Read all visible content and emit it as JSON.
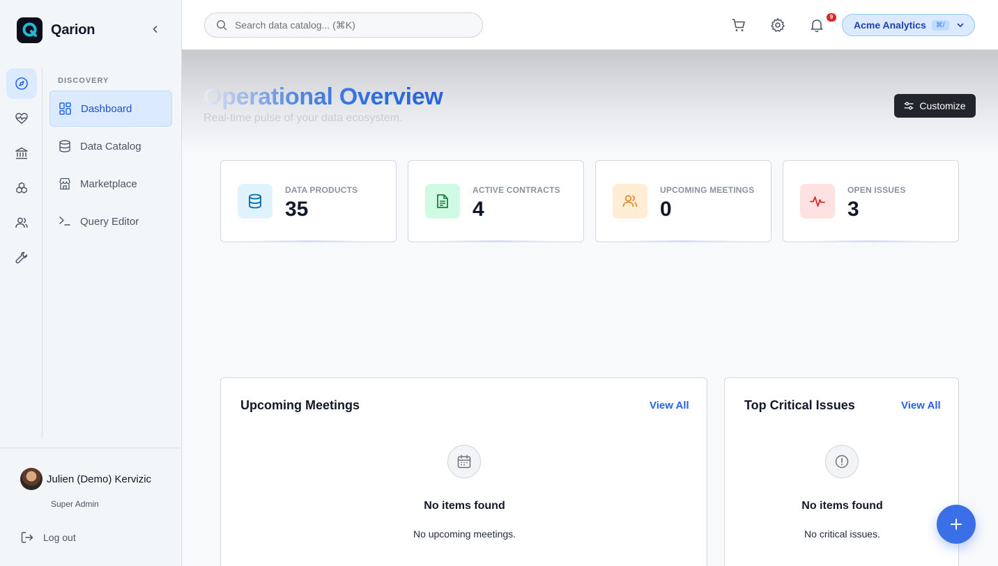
{
  "app": {
    "brand_name": "Qarion"
  },
  "sidebar": {
    "section_label": "DISCOVERY",
    "items": [
      {
        "label": "Dashboard",
        "icon": "dashboard-icon",
        "active": true
      },
      {
        "label": "Data Catalog",
        "icon": "database-icon"
      },
      {
        "label": "Marketplace",
        "icon": "store-icon"
      },
      {
        "label": "Query Editor",
        "icon": "terminal-icon"
      }
    ],
    "rail": [
      "compass-icon",
      "heart-pulse-icon",
      "institution-icon",
      "cubes-icon",
      "users-icon",
      "wrench-icon"
    ],
    "user": {
      "name": "Julien (Demo) Kervizic",
      "role": "Super Admin"
    },
    "logout_label": "Log out"
  },
  "header": {
    "search_placeholder": "Search data catalog... (⌘K)",
    "notification_count": "9",
    "workspace_name": "Acme Analytics",
    "workspace_shortcut": "⌘/"
  },
  "hero": {
    "title": "Operational Overview",
    "subtitle": "Real-time pulse of your data ecosystem.",
    "customize_label": "Customize"
  },
  "stats": [
    {
      "label": "DATA PRODUCTS",
      "value": "35",
      "icon": "database-icon",
      "color": "#0ea5e9",
      "bg": "#e0f2fe"
    },
    {
      "label": "ACTIVE CONTRACTS",
      "value": "4",
      "icon": "document-icon",
      "color": "#16a34a",
      "bg": "#dcfce7"
    },
    {
      "label": "UPCOMING MEETINGS",
      "value": "0",
      "icon": "users-icon",
      "color": "#ea8a2c",
      "bg": "#ffedd5"
    },
    {
      "label": "OPEN ISSUES",
      "value": "3",
      "icon": "activity-icon",
      "color": "#dc2626",
      "bg": "#fee2e2"
    }
  ],
  "panels": {
    "meetings": {
      "title": "Upcoming Meetings",
      "link": "View All",
      "empty_title": "No items found",
      "empty_desc": "No upcoming meetings."
    },
    "issues": {
      "title": "Top Critical Issues",
      "link": "View All",
      "empty_title": "No items found",
      "empty_desc": "No critical issues."
    }
  },
  "colors": {
    "accent": "#2563eb",
    "fab": "#3b6fe8",
    "badge": "#dc2626"
  }
}
